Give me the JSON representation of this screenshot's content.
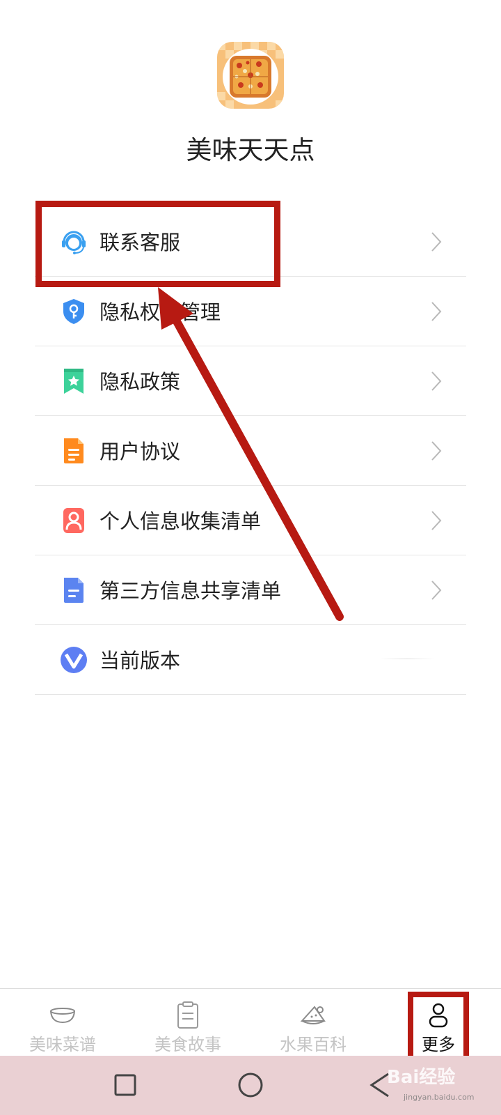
{
  "app": {
    "name": "美味天天点",
    "icon": "pizza-app-icon"
  },
  "menu": {
    "items": [
      {
        "label": "联系客服",
        "icon": "customer-service-headset-icon",
        "color": "#3aa0f0",
        "chevron": true
      },
      {
        "label": "隐私权限管理",
        "icon": "shield-key-icon",
        "color": "#3b8ef0",
        "chevron": true
      },
      {
        "label": "隐私政策",
        "icon": "bookmark-star-icon",
        "color": "#3dd29a",
        "chevron": true
      },
      {
        "label": "用户协议",
        "icon": "document-lines-icon",
        "color": "#ff8a1e",
        "chevron": true
      },
      {
        "label": "个人信息收集清单",
        "icon": "person-card-icon",
        "color": "#ff6860",
        "chevron": true
      },
      {
        "label": "第三方信息共享清单",
        "icon": "document-share-icon",
        "color": "#5b84f0",
        "chevron": true
      },
      {
        "label": "当前版本",
        "icon": "version-v-icon",
        "color": "#5d7ef3",
        "chevron": false
      }
    ]
  },
  "tabs": [
    {
      "label": "美味菜谱",
      "icon": "bowl-icon",
      "active": false
    },
    {
      "label": "美食故事",
      "icon": "clipboard-icon",
      "active": false
    },
    {
      "label": "水果百科",
      "icon": "fruit-icon",
      "active": false
    },
    {
      "label": "更多",
      "icon": "person-icon",
      "active": true
    }
  ],
  "system_nav": {
    "buttons": [
      "recents-square-icon",
      "home-circle-icon",
      "back-triangle-icon"
    ]
  },
  "annotation": {
    "color": "#b71a12"
  },
  "watermark": {
    "text": "Bai经验",
    "sub": "jingyan.baidu.com"
  }
}
